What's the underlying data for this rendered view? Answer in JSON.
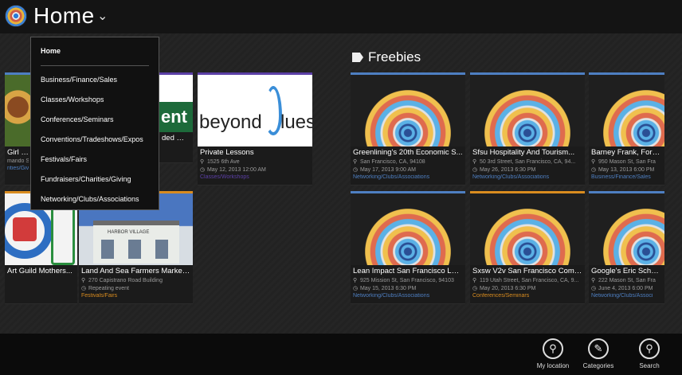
{
  "header": {
    "title": "Home"
  },
  "dropdown": {
    "items": [
      "Home",
      "Business/Finance/Sales",
      "Classes/Workshops",
      "Conferences/Seminars",
      "Conventions/Tradeshows/Expos",
      "Festivals/Fairs",
      "Fundraisers/Charities/Giving",
      "Networking/Clubs/Associations"
    ]
  },
  "left_tiles": [
    {
      "name": "Girl - Er",
      "line1": "mando S",
      "cat": "rities/Giv"
    },
    {
      "name": "ded By...",
      "line1": "",
      "cat": ""
    },
    {
      "name": "Private Lessons",
      "line1": "1525 6th Ave",
      "line2": "May 12, 2013 12:00 AM",
      "cat": "Classes/Workshops",
      "img_text": "beyond",
      "img_text2": "lues"
    },
    {
      "name": "Art Guild Mothers...",
      "line1": "",
      "cat": ""
    },
    {
      "name": "Land And Sea Farmers Market...",
      "line1": "270 Capistrano Road Building",
      "line2": "Repeating event",
      "cat": "Festivals/Fairs",
      "img_text": "HARBOR VILLAGE"
    }
  ],
  "freebies": {
    "title": "Freebies",
    "tiles": [
      {
        "name": "Greenlining's 20th Economic S...",
        "line1": "San Francisco, CA, 94108",
        "line2": "May 17, 2013 9:00 AM",
        "cat": "Networking/Clubs/Associations"
      },
      {
        "name": "Sfsu Hospitality And Tourism...",
        "line1": "50 3rd Street, San Francisco, CA, 94...",
        "line2": "May 26, 2013 6:30 PM",
        "cat": "Networking/Clubs/Associations"
      },
      {
        "name": "Barney Frank, Former",
        "line1": "950 Mason St, San Fra",
        "line2": "May 13, 2013 6:00 PM",
        "cat": "Business/Finance/Sales"
      },
      {
        "name": "Lean Impact San Francisco Lau...",
        "line1": "925 Mission St, San Francisco, 94103",
        "line2": "May 15, 2013 6:30 PM",
        "cat": "Networking/Clubs/Associations"
      },
      {
        "name": "Sxsw V2v San Francisco Comm...",
        "line1": "119 Utah Street, San Francisco, CA, 9...",
        "line2": "May 20, 2013 6:30 PM",
        "cat": "Conferences/Seminars"
      },
      {
        "name": "Google's Eric Schmidt",
        "line1": "222 Mason St, San Fra",
        "line2": "June 4, 2013 6:00 PM",
        "cat": "Networking/Clubs/Associ"
      }
    ]
  },
  "appbar": {
    "location": "My location",
    "categories": "Categories",
    "search": "Search"
  },
  "colors": {
    "accent_blue": "#4e7fc2",
    "accent_purple": "#5b3fa6",
    "accent_orange": "#d98c1f"
  }
}
